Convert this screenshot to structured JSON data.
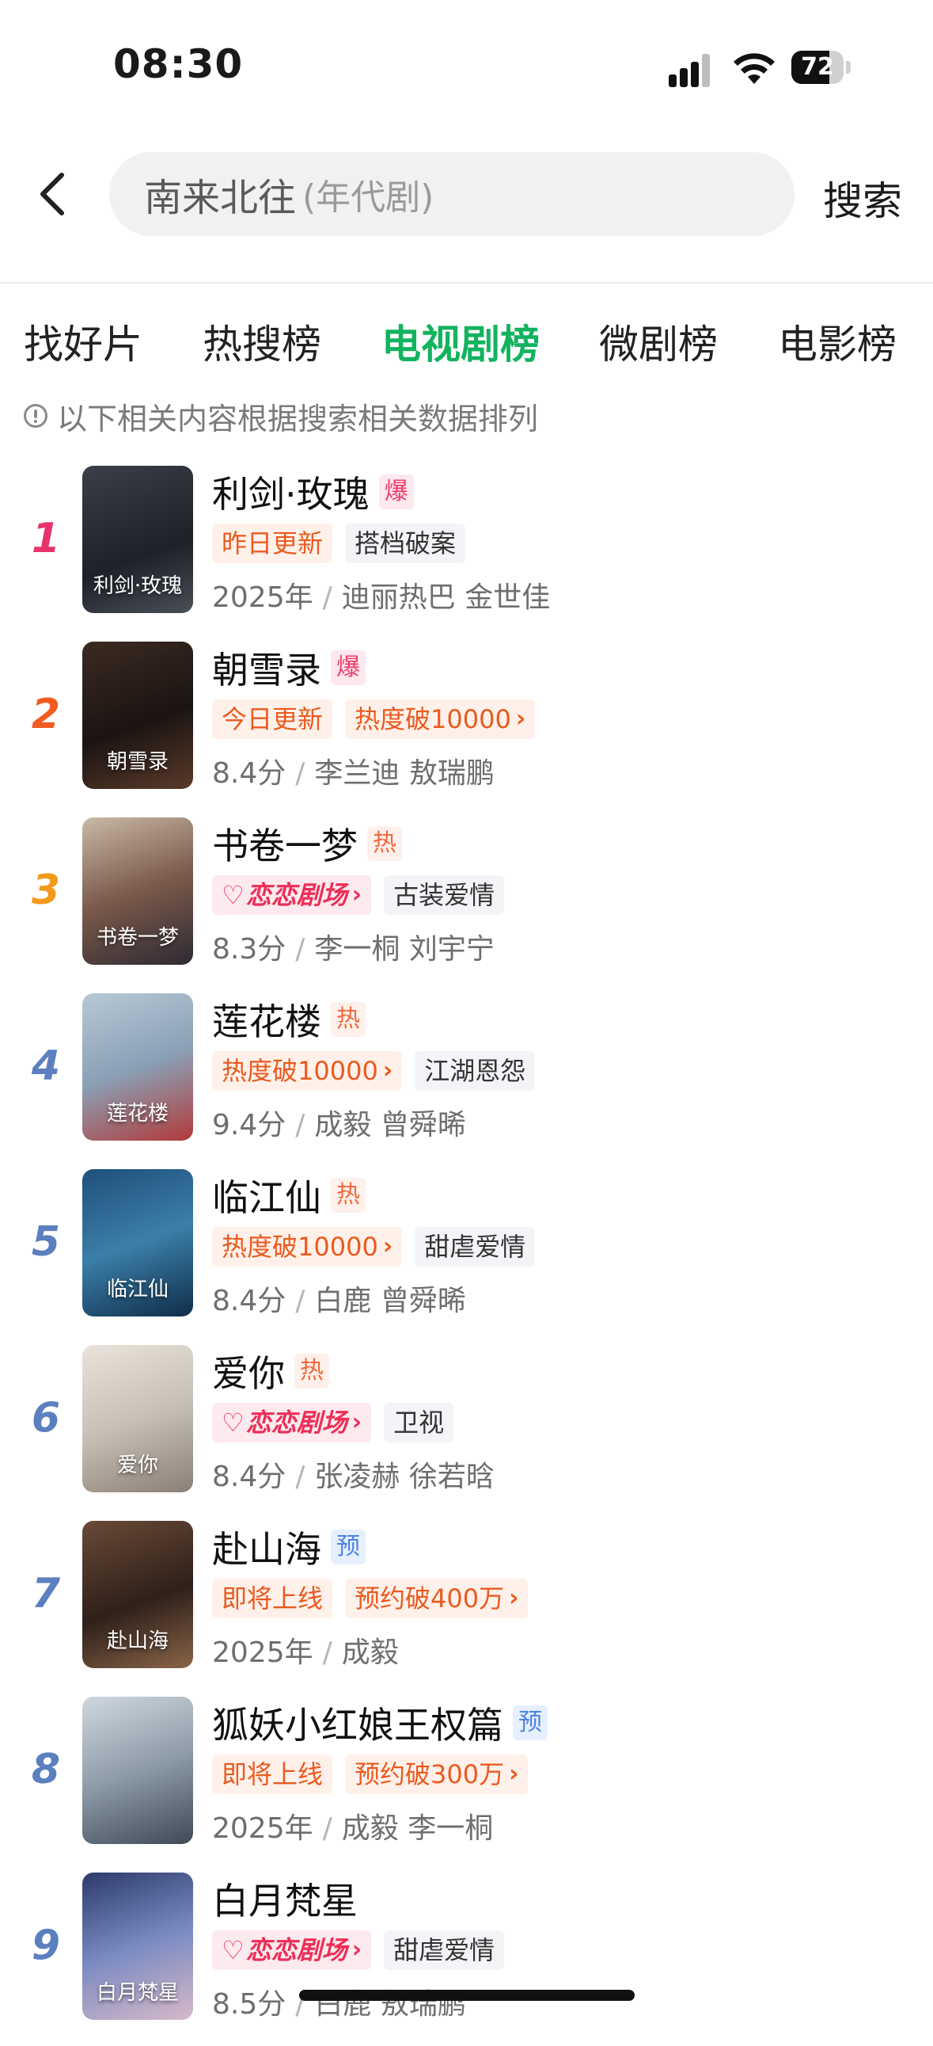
{
  "status_bar": {
    "time": "08:30",
    "battery_level": "72"
  },
  "search": {
    "keyword": "南来北往",
    "hint": "(年代剧)",
    "button_label": "搜索"
  },
  "tabs": [
    {
      "label": "找好片"
    },
    {
      "label": "热搜榜"
    },
    {
      "label": "电视剧榜"
    },
    {
      "label": "微剧榜"
    },
    {
      "label": "电影榜"
    }
  ],
  "active_tab": "电视剧榜",
  "notice": "以下相关内容根据搜索相关数据排列",
  "list": [
    {
      "rank": "1",
      "title": "利剑·玫瑰",
      "badge": "爆",
      "badge_type": "boom",
      "tags": [
        {
          "text": "昨日更新",
          "style": "orange"
        },
        {
          "text": "搭档破案",
          "style": "gray"
        }
      ],
      "meta_first": "2025年",
      "meta_cast": "迪丽热巴 金世佳",
      "poster_text": "利剑·玫瑰"
    },
    {
      "rank": "2",
      "title": "朝雪录",
      "badge": "爆",
      "badge_type": "boom",
      "tags": [
        {
          "text": "今日更新",
          "style": "orange"
        },
        {
          "text": "热度破10000",
          "style": "orange",
          "chevron": true
        }
      ],
      "meta_first": "8.4分",
      "meta_cast": "李兰迪 敖瑞鹏",
      "poster_text": "朝雪录"
    },
    {
      "rank": "3",
      "title": "书卷一梦",
      "badge": "热",
      "badge_type": "hot",
      "tags": [
        {
          "text": "恋恋剧场",
          "style": "pink",
          "chevron": true
        },
        {
          "text": "古装爱情",
          "style": "gray"
        }
      ],
      "meta_first": "8.3分",
      "meta_cast": "李一桐 刘宇宁",
      "poster_text": "书卷一梦"
    },
    {
      "rank": "4",
      "title": "莲花楼",
      "badge": "热",
      "badge_type": "hot",
      "tags": [
        {
          "text": "热度破10000",
          "style": "orange",
          "chevron": true
        },
        {
          "text": "江湖恩怨",
          "style": "gray"
        }
      ],
      "meta_first": "9.4分",
      "meta_cast": "成毅 曾舜晞",
      "poster_text": "莲花楼"
    },
    {
      "rank": "5",
      "title": "临江仙",
      "badge": "热",
      "badge_type": "hot",
      "tags": [
        {
          "text": "热度破10000",
          "style": "orange",
          "chevron": true
        },
        {
          "text": "甜虐爱情",
          "style": "gray"
        }
      ],
      "meta_first": "8.4分",
      "meta_cast": "白鹿 曾舜晞",
      "poster_text": "临江仙"
    },
    {
      "rank": "6",
      "title": "爱你",
      "badge": "热",
      "badge_type": "hot",
      "tags": [
        {
          "text": "恋恋剧场",
          "style": "pink",
          "chevron": true
        },
        {
          "text": "卫视",
          "style": "gray"
        }
      ],
      "meta_first": "8.4分",
      "meta_cast": "张凌赫 徐若晗",
      "poster_text": "爱你"
    },
    {
      "rank": "7",
      "title": "赴山海",
      "badge": "预",
      "badge_type": "pre",
      "tags": [
        {
          "text": "即将上线",
          "style": "orange"
        },
        {
          "text": "预约破400万",
          "style": "orange",
          "chevron": true
        }
      ],
      "meta_first": "2025年",
      "meta_cast": "成毅",
      "poster_text": "赴山海"
    },
    {
      "rank": "8",
      "title": "狐妖小红娘王权篇",
      "badge": "预",
      "badge_type": "pre",
      "tags": [
        {
          "text": "即将上线",
          "style": "orange"
        },
        {
          "text": "预约破300万",
          "style": "orange",
          "chevron": true
        }
      ],
      "meta_first": "2025年",
      "meta_cast": "成毅 李一桐",
      "poster_text": ""
    },
    {
      "rank": "9",
      "title": "白月梵星",
      "badge": "",
      "badge_type": "",
      "tags": [
        {
          "text": "恋恋剧场",
          "style": "pink",
          "chevron": true
        },
        {
          "text": "甜虐爱情",
          "style": "gray"
        }
      ],
      "meta_first": "8.5分",
      "meta_cast": "白鹿 敖瑞鹏",
      "poster_text": "白月梵星"
    }
  ],
  "colors": {
    "accent_green": "#12b35e",
    "rank_1": "#e8336a",
    "rank_2": "#f25a1f",
    "rank_3": "#f39a1a",
    "rank_other": "#5b7fbf"
  }
}
